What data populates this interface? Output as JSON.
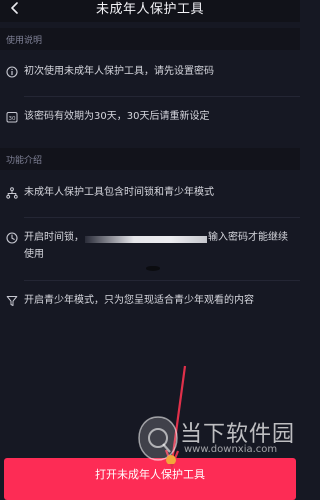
{
  "header": {
    "title": "未成年人保护工具",
    "back_icon": "chevron-left-icon"
  },
  "sections": {
    "usage": {
      "label": "使用说明",
      "items": [
        {
          "icon": "info-icon",
          "text": "初次使用未成年人保护工具，请先设置密码"
        },
        {
          "icon": "calendar-30-icon",
          "icon_text": "30",
          "text": "该密码有效期为30天，30天后请重新设定"
        }
      ]
    },
    "features": {
      "label": "功能介绍",
      "items": [
        {
          "icon": "network-icon",
          "text": "未成年人保护工具包含时间锁和青少年模式"
        },
        {
          "icon": "clock-icon",
          "text_before": "开启时间锁，",
          "text_after": "输入密码才能继续",
          "text_line2": "使用"
        },
        {
          "icon": "filter-icon",
          "text": "开启青少年模式，只为您呈现适合青少年观看的内容"
        }
      ]
    }
  },
  "cta": {
    "label": "打开未成年人保护工具"
  },
  "watermark": {
    "name": "当下软件园",
    "url": "www.downxia.com"
  },
  "colors": {
    "background": "#161823",
    "section_bg": "#12131b",
    "accent": "#fd2c55",
    "arrow": "#e0304a"
  }
}
